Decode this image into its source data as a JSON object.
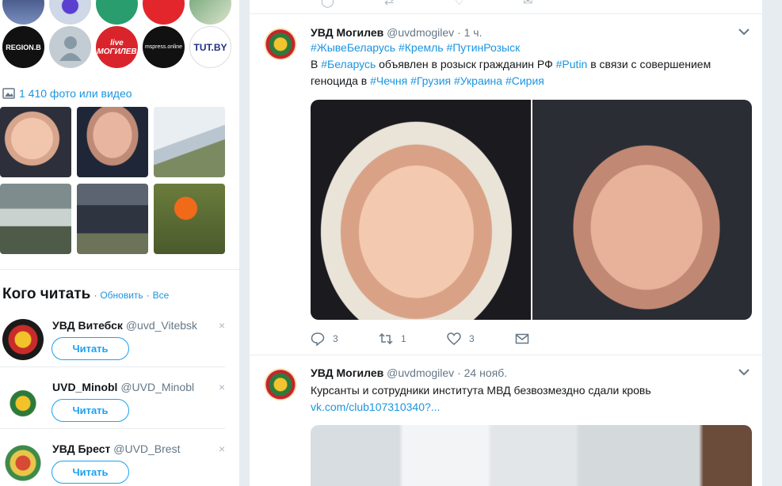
{
  "left": {
    "media_count_label": "1 410 фото или видео",
    "top_avatars": [
      {
        "name": "avatar-1"
      },
      {
        "name": "avatar-2"
      },
      {
        "name": "avatar-3"
      },
      {
        "name": "avatar-4"
      },
      {
        "name": "avatar-5"
      }
    ],
    "avatars_row2": [
      {
        "label": "REGION.B"
      },
      {
        "label": ""
      },
      {
        "label": "live МОГИЛЕВ"
      },
      {
        "label": "mspress.online"
      },
      {
        "label": "TUT.BY"
      }
    ],
    "who_to_follow": {
      "title": "Кого читать",
      "refresh": "Обновить",
      "all": "Все",
      "follow_label": "Читать",
      "dismiss": "×",
      "accounts": [
        {
          "name": "УВД Витебск",
          "handle": "@uvd_Vitebsk"
        },
        {
          "name": "UVD_Minobl",
          "handle": "@UVD_Minobl"
        },
        {
          "name": "УВД Брест",
          "handle": "@UVD_Brest"
        }
      ]
    }
  },
  "timeline": {
    "tweets": [
      {
        "author": "УВД Могилев",
        "handle": "@uvdmogilev",
        "time": "· 1 ч.",
        "hashtags_line": "#ЖывеБеларусь #Кремль #ПутинРозыск",
        "text_parts": [
          "В ",
          "#Беларусь",
          " объявлен в розыск гражданин РФ ",
          "#Putin",
          " в связи с совершением"
        ],
        "text_line2_parts": [
          "геноцида в ",
          "#Чечня",
          " ",
          "#Грузия",
          " ",
          "#Украина",
          " ",
          "#Сирия"
        ],
        "replies": "3",
        "retweets": "1",
        "likes": "3"
      },
      {
        "author": "УВД Могилев",
        "handle": "@uvdmogilev",
        "time": "· 24 нояб.",
        "text": "Курсанты и сотрудники института МВД безвозмездно сдали кровь",
        "link": "vk.com/club107310340?..."
      }
    ]
  }
}
